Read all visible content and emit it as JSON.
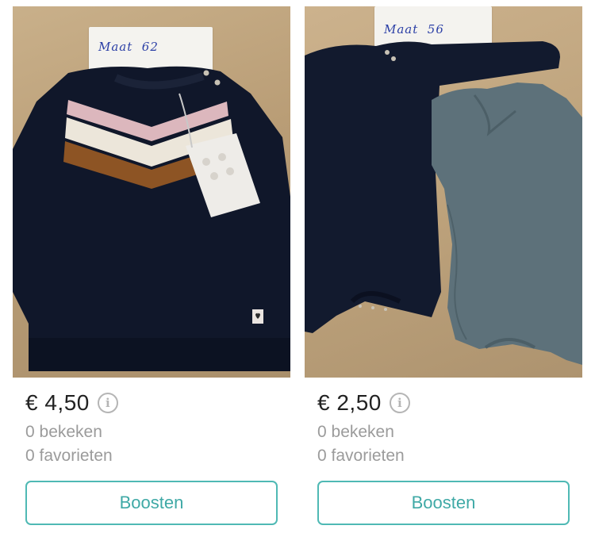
{
  "listings": [
    {
      "size_note": "Maat  62",
      "price": "€ 4,50",
      "info_icon": "info-icon",
      "views": "0 bekeken",
      "favorites": "0 favorieten",
      "boost_label": "Boosten"
    },
    {
      "size_note": "Maat  56",
      "price": "€ 2,50",
      "info_icon": "info-icon",
      "views": "0 bekeken",
      "favorites": "0 favorieten",
      "boost_label": "Boosten"
    }
  ],
  "colors": {
    "accent": "#4fb9b4",
    "price_text": "#222222",
    "muted_text": "#9b9b9b",
    "info_icon": "#b5b5b5"
  }
}
